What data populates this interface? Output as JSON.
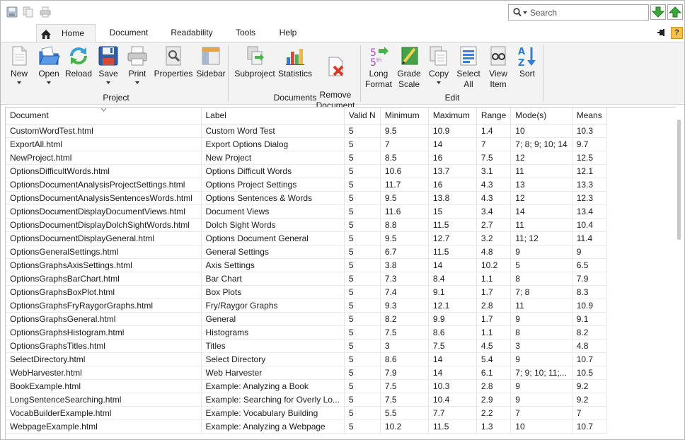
{
  "search": {
    "placeholder": "Search"
  },
  "tabs": [
    "Home",
    "Document",
    "Readability",
    "Tools",
    "Help"
  ],
  "help_label": "?",
  "ribbon": {
    "buttons": [
      {
        "label": "New",
        "icon": "new-document-icon"
      },
      {
        "label": "Open",
        "icon": "open-folder-icon"
      },
      {
        "label": "Reload",
        "icon": "reload-icon"
      },
      {
        "label": "Save",
        "icon": "save-disk-icon"
      },
      {
        "label": "Print",
        "icon": "printer-icon"
      },
      {
        "label": "Properties",
        "icon": "properties-icon"
      },
      {
        "label": "Sidebar",
        "icon": "sidebar-icon"
      },
      {
        "label": "Subproject",
        "icon": "subproject-icon"
      },
      {
        "label": "Statistics",
        "icon": "statistics-icon"
      },
      {
        "label": "Remove\nDocument",
        "icon": "remove-document-icon"
      },
      {
        "label": "Long\nFormat",
        "icon": "long-format-icon"
      },
      {
        "label": "Grade\nScale",
        "icon": "grade-scale-icon"
      },
      {
        "label": "Copy",
        "icon": "copy-icon"
      },
      {
        "label": "Select\nAll",
        "icon": "select-all-icon"
      },
      {
        "label": "View\nItem",
        "icon": "view-item-icon"
      },
      {
        "label": "Sort",
        "icon": "sort-az-icon"
      }
    ],
    "groups": [
      "Project",
      "Documents",
      "Edit"
    ]
  },
  "table": {
    "columns": [
      "Document",
      "Label",
      "Valid N",
      "Minimum",
      "Maximum",
      "Range",
      "Mode(s)",
      "Means"
    ],
    "rows": [
      [
        "CustomWordTest.html",
        "Custom Word Test",
        "5",
        "9.5",
        "10.9",
        "1.4",
        "10",
        "10.3"
      ],
      [
        "ExportAll.html",
        "Export Options Dialog",
        "5",
        "7",
        "14",
        "7",
        "7; 8; 9; 10; 14",
        "9.7"
      ],
      [
        "NewProject.html",
        "New Project",
        "5",
        "8.5",
        "16",
        "7.5",
        "12",
        "12.5"
      ],
      [
        "OptionsDifficultWords.html",
        "Options Difficult Words",
        "5",
        "10.6",
        "13.7",
        "3.1",
        "11",
        "12.1"
      ],
      [
        "OptionsDocumentAnalysisProjectSettings.html",
        "Options Project Settings",
        "5",
        "11.7",
        "16",
        "4.3",
        "13",
        "13.3"
      ],
      [
        "OptionsDocumentAnalysisSentencesWords.html",
        "Options Sentences & Words",
        "5",
        "9.5",
        "13.8",
        "4.3",
        "12",
        "12.3"
      ],
      [
        "OptionsDocumentDisplayDocumentViews.html",
        "Document Views",
        "5",
        "11.6",
        "15",
        "3.4",
        "14",
        "13.4"
      ],
      [
        "OptionsDocumentDisplayDolchSightWords.html",
        "Dolch Sight Words",
        "5",
        "8.8",
        "11.5",
        "2.7",
        "11",
        "10.4"
      ],
      [
        "OptionsDocumentDisplayGeneral.html",
        "Options Document General",
        "5",
        "9.5",
        "12.7",
        "3.2",
        "11; 12",
        "11.4"
      ],
      [
        "OptionsGeneralSettings.html",
        "General Settings",
        "5",
        "6.7",
        "11.5",
        "4.8",
        "9",
        "9"
      ],
      [
        "OptionsGraphsAxisSettings.html",
        "Axis Settings",
        "5",
        "3.8",
        "14",
        "10.2",
        "5",
        "6.5"
      ],
      [
        "OptionsGraphsBarChart.html",
        "Bar Chart",
        "5",
        "7.3",
        "8.4",
        "1.1",
        "8",
        "7.9"
      ],
      [
        "OptionsGraphsBoxPlot.html",
        "Box Plots",
        "5",
        "7.4",
        "9.1",
        "1.7",
        "7; 8",
        "8.3"
      ],
      [
        "OptionsGraphsFryRaygorGraphs.html",
        "Fry/Raygor Graphs",
        "5",
        "9.3",
        "12.1",
        "2.8",
        "11",
        "10.9"
      ],
      [
        "OptionsGraphsGeneral.html",
        "General",
        "5",
        "8.2",
        "9.9",
        "1.7",
        "9",
        "9.1"
      ],
      [
        "OptionsGraphsHistogram.html",
        "Histograms",
        "5",
        "7.5",
        "8.6",
        "1.1",
        "8",
        "8.2"
      ],
      [
        "OptionsGraphsTitles.html",
        "Titles",
        "5",
        "3",
        "7.5",
        "4.5",
        "3",
        "4.8"
      ],
      [
        "SelectDirectory.html",
        "Select Directory",
        "5",
        "8.6",
        "14",
        "5.4",
        "9",
        "10.7"
      ],
      [
        "WebHarvester.html",
        "Web Harvester",
        "5",
        "7.9",
        "14",
        "6.1",
        "7; 9; 10; 11;...",
        "10.5"
      ],
      [
        "BookExample.html",
        "Example: Analyzing a Book",
        "5",
        "7.5",
        "10.3",
        "2.8",
        "9",
        "9.2"
      ],
      [
        "LongSentenceSearching.html",
        "Example: Searching for Overly Lo...",
        "5",
        "7.5",
        "10.4",
        "2.9",
        "9",
        "9.2"
      ],
      [
        "VocabBuilderExample.html",
        "Example: Vocabulary Building",
        "5",
        "5.5",
        "7.7",
        "2.2",
        "7",
        "7"
      ],
      [
        "WebpageExample.html",
        "Example: Analyzing a Webpage",
        "5",
        "10.2",
        "11.5",
        "1.3",
        "10",
        "10.7"
      ]
    ]
  },
  "colors": {
    "ribbon_bg": "#f3f3f3",
    "accent_green": "#3aa83a",
    "help_yellow": "#f6c14a"
  }
}
